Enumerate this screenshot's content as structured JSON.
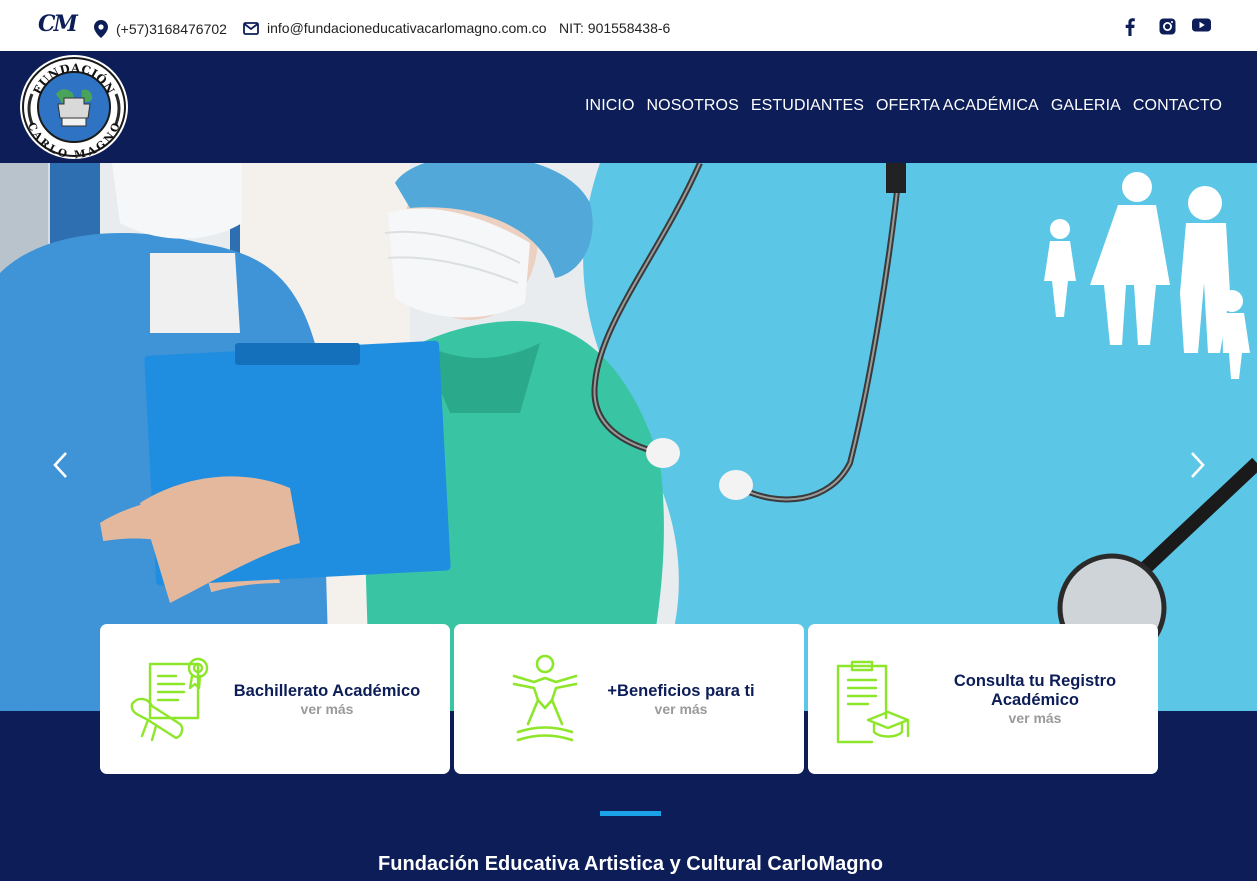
{
  "topbar": {
    "logo_text": "CM",
    "phone": "(+57)3168476702",
    "email": "info@fundacioneducativacarlomagno.com.co",
    "nit": "NIT: 901558438-6",
    "social": [
      "facebook-icon",
      "instagram-icon",
      "youtube-icon"
    ]
  },
  "header": {
    "logo_top_text": "FUNDACIÓN",
    "logo_bottom_text": "CARLO MAGNO",
    "nav": [
      "INICIO",
      "NOSOTROS",
      "ESTUDIANTES",
      "OFERTA ACADÉMICA",
      "GALERIA",
      "CONTACTO"
    ]
  },
  "hero": {
    "prev_icon": "chevron-left-icon",
    "next_icon": "chevron-right-icon"
  },
  "cards": [
    {
      "title": "Bachillerato Académico",
      "more": "ver más",
      "icon": "certificate-icon"
    },
    {
      "title": "+Beneficios para ti",
      "more": "ver más",
      "icon": "person-stretch-icon"
    },
    {
      "title": "Consulta tu Registro Académico",
      "more": "ver más",
      "icon": "clipboard-graduation-icon"
    }
  ],
  "bottom": {
    "title": "Fundación Educativa Artistica y Cultural CarloMagno"
  },
  "colors": {
    "navy": "#0c1d58",
    "accent_green": "#8ee62a",
    "accent_blue": "#1aa3e8",
    "hero_blue": "#5cc6e6"
  }
}
